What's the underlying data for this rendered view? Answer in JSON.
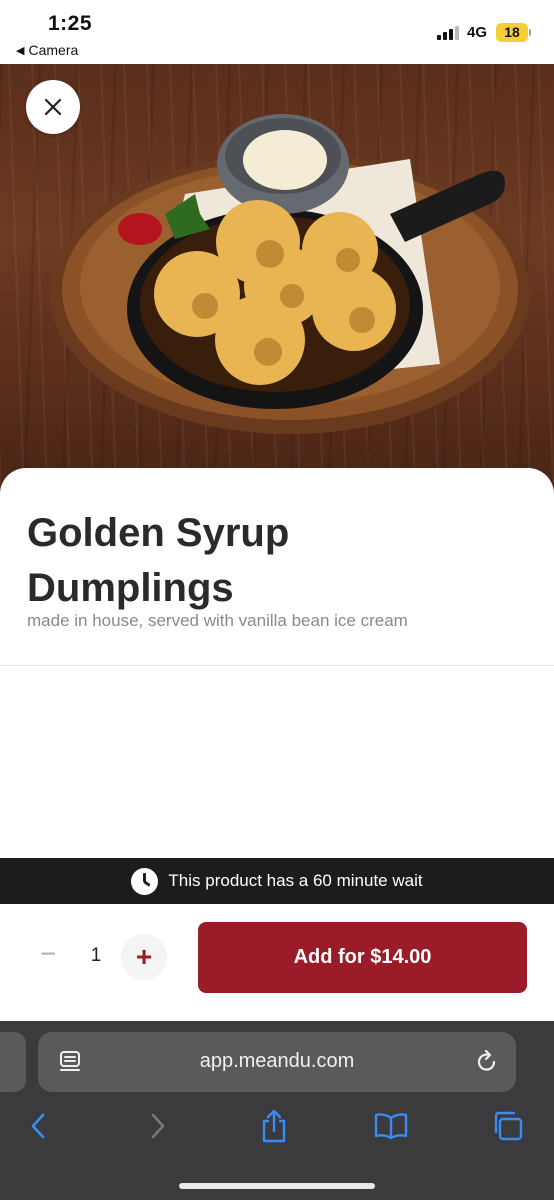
{
  "status_bar": {
    "time": "1:25",
    "back_app": "Camera",
    "network": "4G",
    "battery": "18"
  },
  "hero": {
    "image_icon": "dessert-photo",
    "close_icon": "close-icon"
  },
  "product": {
    "title": "Golden Syrup Dumplings",
    "description": "made in house, served with vanilla bean ice cream"
  },
  "wait_banner": {
    "text": "This product has a 60 minute wait",
    "icon": "clock-icon"
  },
  "order": {
    "minus_label": "−",
    "quantity": "1",
    "plus_label": "+",
    "add_button": "Add for $14.00",
    "accent_color": "#9b1b28"
  },
  "browser": {
    "url": "app.meandu.com",
    "toolbar_icons": [
      "back-icon",
      "forward-icon",
      "share-icon",
      "bookmarks-icon",
      "tabs-icon"
    ]
  }
}
